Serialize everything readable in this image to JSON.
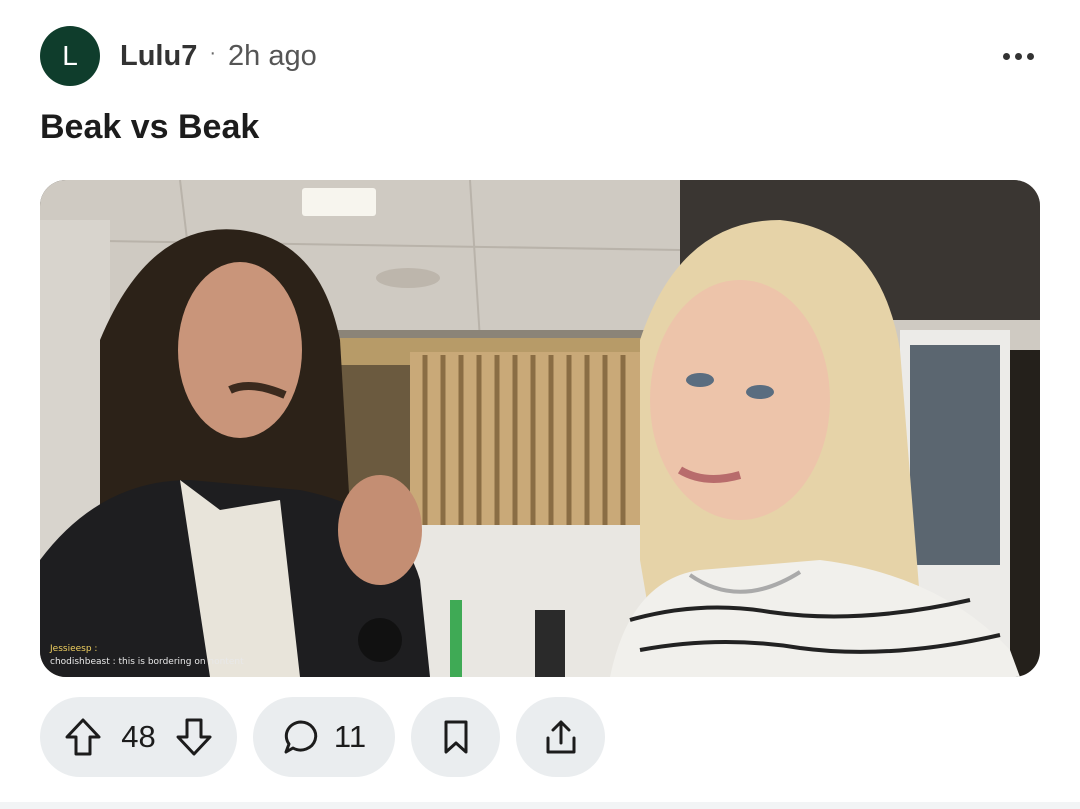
{
  "post": {
    "author_initial": "L",
    "author": "Lulu7",
    "separator": "·",
    "time": "2h ago",
    "title": "Beak vs Beak"
  },
  "media": {
    "chat_line1": "Jessieesp :",
    "chat_line2": "chodishbeast : this is bordering on nontent"
  },
  "actions": {
    "upvotes": "48",
    "comments": "11"
  },
  "colors": {
    "avatar_bg": "#0f3d2c",
    "pill_bg": "#eaedef"
  }
}
